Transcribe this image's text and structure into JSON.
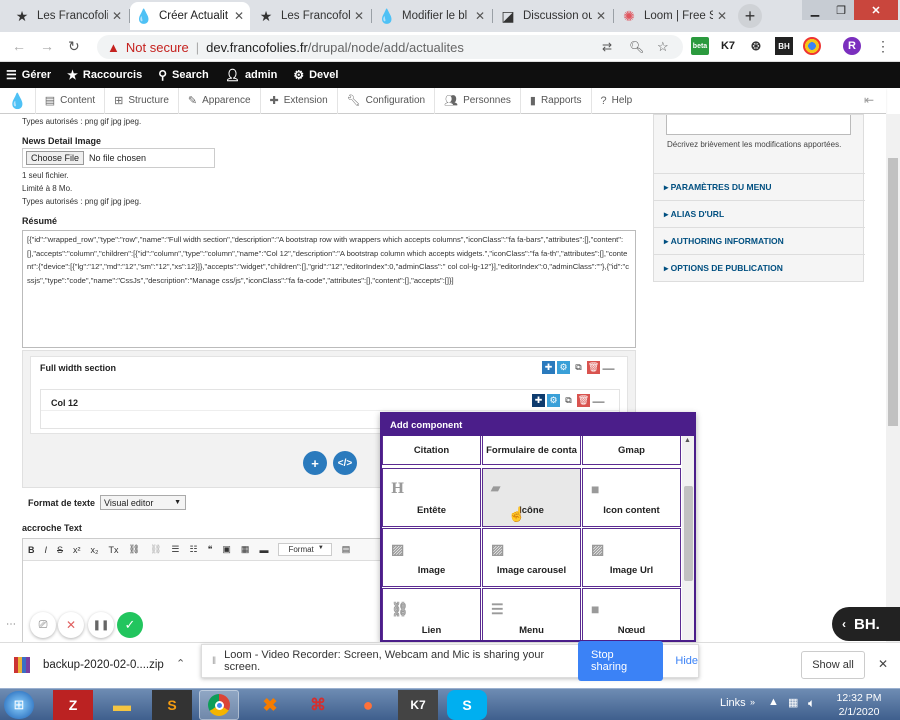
{
  "browser": {
    "tabs": [
      {
        "title": "Les Francofolies",
        "icon": "star-icon",
        "active": false
      },
      {
        "title": "Créer Actualit",
        "icon": "drupal-icon",
        "active": true
      },
      {
        "title": "Les Francofolie",
        "icon": "star-icon",
        "active": false
      },
      {
        "title": "Modifier le bl",
        "icon": "drupal-icon",
        "active": false
      },
      {
        "title": "Discussion ou",
        "icon": "discussion-icon",
        "active": false
      },
      {
        "title": "Loom | Free S",
        "icon": "loom-icon",
        "active": false
      }
    ],
    "new_tab": "+",
    "security_label": "Not secure",
    "url_host": "dev.francofolies.fr",
    "url_path": "/drupal/node/add/actualites",
    "profile_initial": "R",
    "extensions": {
      "k7": "K7",
      "bh": "BH",
      "beta": "beta"
    }
  },
  "admin_toolbar": {
    "items": [
      {
        "label": "Gérer",
        "icon": "hamburger-icon"
      },
      {
        "label": "Raccourcis",
        "icon": "star-icon"
      },
      {
        "label": "Search",
        "icon": "search-icon"
      },
      {
        "label": "admin",
        "icon": "user-icon"
      },
      {
        "label": "Devel",
        "icon": "gear-icon"
      }
    ]
  },
  "admin_tray": {
    "items": [
      {
        "label": "Content",
        "icon": "content-icon"
      },
      {
        "label": "Structure",
        "icon": "structure-icon"
      },
      {
        "label": "Apparence",
        "icon": "appearance-icon"
      },
      {
        "label": "Extension",
        "icon": "extension-icon"
      },
      {
        "label": "Configuration",
        "icon": "wrench-icon"
      },
      {
        "label": "Personnes",
        "icon": "people-icon"
      },
      {
        "label": "Rapports",
        "icon": "reports-icon"
      },
      {
        "label": "Help",
        "icon": "help-icon"
      }
    ]
  },
  "form": {
    "types_top": "Types autorisés : png gif jpg jpeg.",
    "news_detail_label": "News Detail Image",
    "choose_file": "Choose File",
    "no_file": "No file chosen",
    "one_file": "1 seul fichier.",
    "limit": "Limité à 8 Mo.",
    "types": "Types autorisés : png gif jpg jpeg.",
    "resume_label": "Résumé",
    "resume_value": "[{\"id\":\"wrapped_row\",\"type\":\"row\",\"name\":\"Full width section\",\"description\":\"A bootstrap row with wrappers which accepts columns\",\"iconClass\":\"fa fa-bars\",\"attributes\":[],\"content\":[],\"accepts\":\"column\",\"children\":[{\"id\":\"column\",\"type\":\"column\",\"name\":\"Col 12\",\"description\":\"A bootstrap column which accepts widgets.\",\"iconClass\":\"fa fa-th\",\"attributes\":[],\"content\":{\"device\":[{\"lg\":\"12\",\"md\":\"12\",\"sm\":\"12\",\"xs\":12}]},\"accepts\":\"widget\",\"children\":[],\"grid\":\"12\",\"editorIndex\":0,\"adminClass\":\" col col-lg-12\"}],\"editorIndex\":0,\"adminClass\":\"\"},{\"id\":\"cssjs\",\"type\":\"code\",\"name\":\"CssJs\",\"description\":\"Manage css/js\",\"iconClass\":\"fa fa-code\",\"attributes\":[],\"content\":[],\"accepts\":[]}]",
    "section_title": "Full width section",
    "col_title": "Col 12",
    "format_label": "Format de texte",
    "format_value": "Visual editor",
    "accroche_label": "accroche Text",
    "editor_format": "Format"
  },
  "sidebar": {
    "revision_help": "Décrivez brièvement les modifications apportées.",
    "sections": [
      "PARAMÈTRES DU MENU",
      "ALIAS D'URL",
      "AUTHORING INFORMATION",
      "OPTIONS DE PUBLICATION"
    ]
  },
  "popup": {
    "title": "Add component",
    "top_row": [
      "Citation",
      "Formulaire de conta",
      "Gmap"
    ],
    "components": [
      {
        "label": "Entête",
        "icon": "heading-icon"
      },
      {
        "label": "Icône",
        "icon": "icon-placeholder-icon"
      },
      {
        "label": "Icon content",
        "icon": "square-icon"
      },
      {
        "label": "Image",
        "icon": "image-icon"
      },
      {
        "label": "Image carousel",
        "icon": "image-icon"
      },
      {
        "label": "Image Url",
        "icon": "image-icon"
      },
      {
        "label": "Lien",
        "icon": "link-icon"
      },
      {
        "label": "Menu",
        "icon": "menu-icon"
      },
      {
        "label": "Nœud",
        "icon": "square-icon"
      }
    ]
  },
  "loom": {
    "message": "Loom - Video Recorder: Screen, Webcam and Mic is sharing your screen.",
    "stop": "Stop sharing",
    "hide": "Hide"
  },
  "downloads": {
    "file": "backup-2020-02-0....zip",
    "show_all": "Show all"
  },
  "taskbar": {
    "links": "Links",
    "time": "12:32 PM",
    "date": "2/1/2020"
  },
  "bh_badge": "BH."
}
